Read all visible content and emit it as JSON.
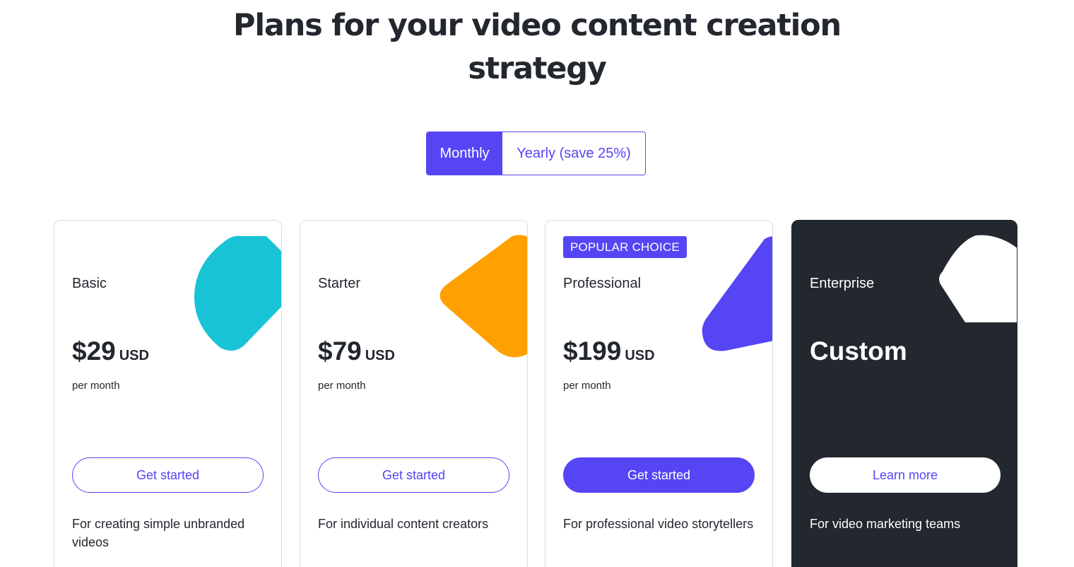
{
  "header": {
    "title_line1": "Plans for your video content creation",
    "title_line2": "strategy"
  },
  "billing_toggle": {
    "monthly_label": "Monthly",
    "yearly_label": "Yearly (save 25%)",
    "selected": "Monthly"
  },
  "plans": [
    {
      "name": "Basic",
      "price": "$29",
      "currency": "USD",
      "period": "per month",
      "cta_label": "Get started",
      "description": "For creating simple unbranded videos",
      "accent_color": "#19c3d6"
    },
    {
      "name": "Starter",
      "price": "$79",
      "currency": "USD",
      "period": "per month",
      "cta_label": "Get started",
      "description": "For individual content creators",
      "accent_color": "#ffa000"
    },
    {
      "badge": "POPULAR CHOICE",
      "name": "Professional",
      "price": "$199",
      "currency": "USD",
      "period": "per month",
      "cta_label": "Get started",
      "description": "For professional video storytellers",
      "accent_color": "#5545f5"
    },
    {
      "name": "Enterprise",
      "price": "Custom",
      "cta_label": "Learn more",
      "description": "For video marketing teams",
      "accent_color": "#ffffff"
    }
  ],
  "colors": {
    "brand_purple": "#5545f5",
    "dark_card": "#23272e",
    "text": "#23272e"
  }
}
